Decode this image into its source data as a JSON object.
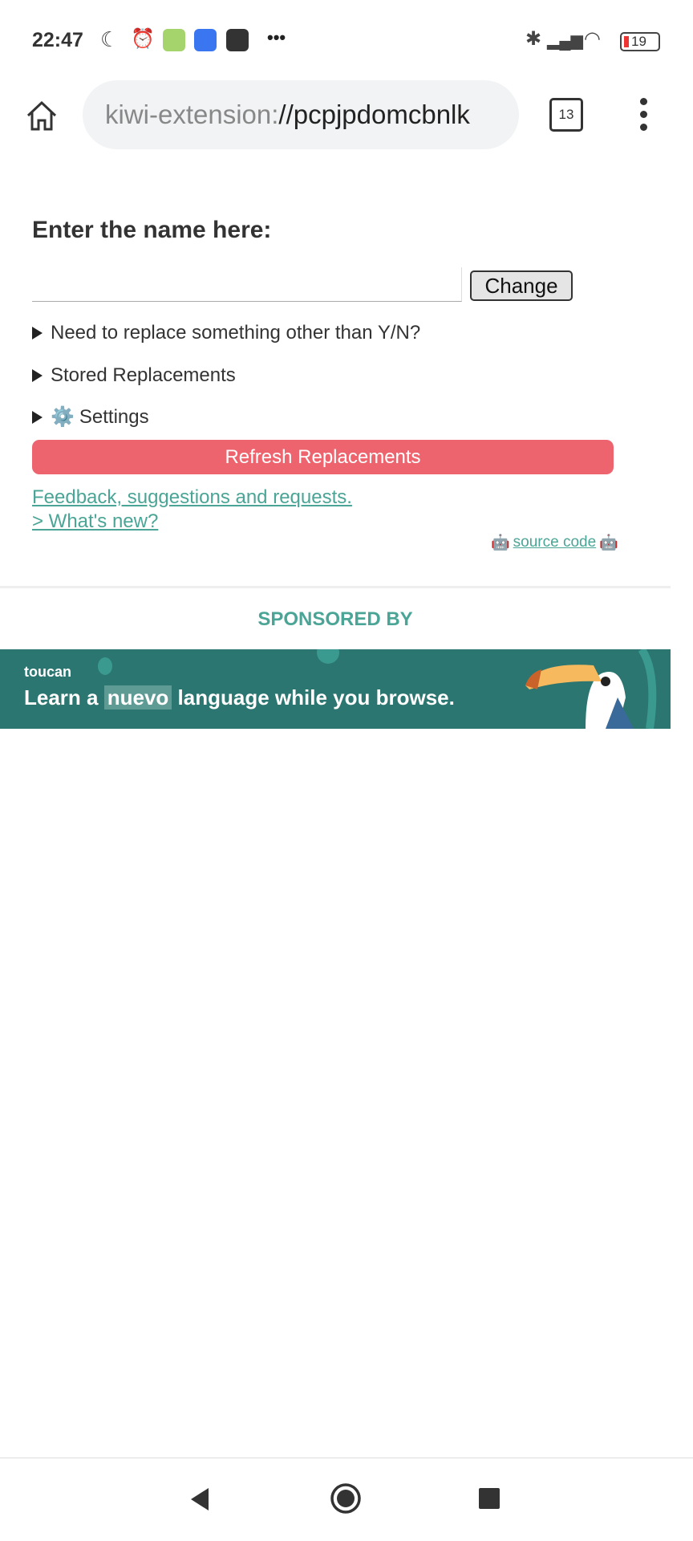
{
  "status_bar": {
    "time": "22:47",
    "battery": "19",
    "more": "•••"
  },
  "browser": {
    "url_scheme": "kiwi-extension:",
    "url_rest": "//pcpjpdomcbnlk",
    "tab_count": "13"
  },
  "page": {
    "heading": "Enter the name here:",
    "name_input": {
      "value": "",
      "placeholder": ""
    },
    "change_button": "Change",
    "sections": [
      "Need to replace something other than Y/N?",
      "Stored Replacements",
      "Settings"
    ],
    "settings_icon": "⚙️",
    "refresh_button": "Refresh Replacements",
    "feedback_link": "Feedback, suggestions and requests.",
    "whats_new_link": "> What's new?",
    "source_code": {
      "label": "source code",
      "icon": "🤖"
    },
    "sponsored_label": "SPONSORED BY",
    "ad": {
      "brand": "toucan",
      "text_before": "Learn a",
      "highlight": "nuevo",
      "text_after": "language while you browse."
    }
  },
  "colors": {
    "accent": "#4aa596",
    "refresh": "#ee646e",
    "banner": "#2b7670"
  }
}
